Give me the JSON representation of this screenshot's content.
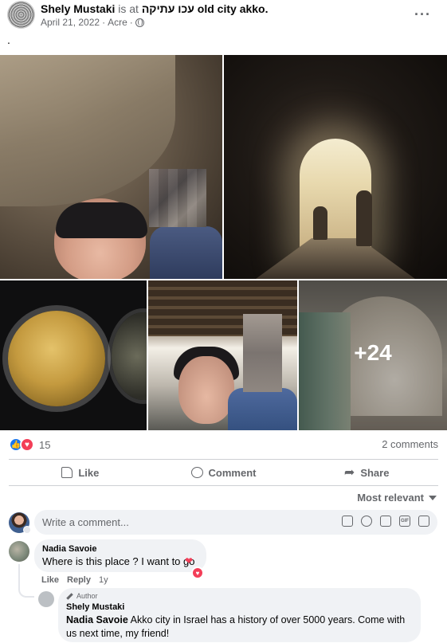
{
  "post": {
    "author": "Shely Mustaki",
    "is_at": "is at",
    "place": "עכו עתיקה old city akko.",
    "date": "April 21, 2022",
    "location": "Acre",
    "dot": "·",
    "more": "···",
    "text": "."
  },
  "photos": {
    "more_count": "+24"
  },
  "reactions": {
    "count": "15",
    "comments_count": "2 comments"
  },
  "actions": {
    "like": "Like",
    "comment": "Comment",
    "share": "Share"
  },
  "sort": {
    "label": "Most relevant"
  },
  "composer": {
    "placeholder": "Write a comment..."
  },
  "comments": [
    {
      "author": "Nadia Savoie",
      "text": "Where is this place ? I want to go",
      "like": "Like",
      "reply": "Reply",
      "time": "1y"
    },
    {
      "badge": "Author",
      "author": "Shely Mustaki",
      "mention": "Nadia Savoie",
      "text": " Akko city in Israel has a history of over 5000 years. Come with us next time, my friend!"
    }
  ],
  "colors": {
    "like_blue": "#1877f2",
    "love_red": "#f33e58",
    "secondary_text": "#65676b",
    "bubble_bg": "#f0f2f5"
  }
}
